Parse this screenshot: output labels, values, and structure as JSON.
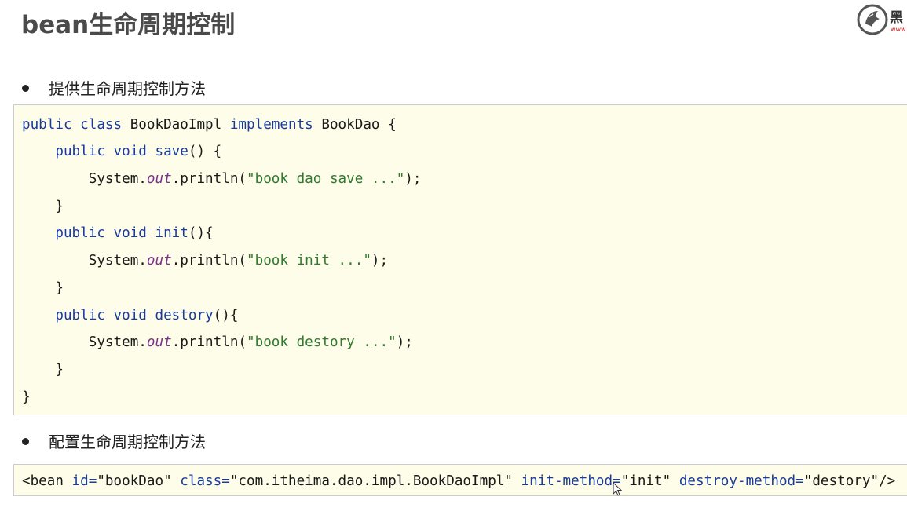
{
  "slide": {
    "title": "bean生命周期控制",
    "logo": {
      "icon": "heima-horse-logo-icon",
      "text": "黑",
      "subtext": "www",
      "accent_color": "#cc2222"
    }
  },
  "sections": [
    {
      "bullet": "提供生命周期控制方法",
      "code_lines": [
        "public class BookDaoImpl implements BookDao {",
        "    public void save() {",
        "        System.out.println(\"book dao save ...\");",
        "    }",
        "    public void init(){",
        "        System.out.println(\"book init ...\");",
        "    }",
        "    public void destory(){",
        "        System.out.println(\"book destory ...\");",
        "    }",
        "}"
      ]
    },
    {
      "bullet": "配置生命周期控制方法",
      "code_lines": [
        "<bean id=\"bookDao\" class=\"com.itheima.dao.impl.BookDaoImpl\" init-method=\"init\" destroy-method=\"destory\"/>"
      ]
    }
  ],
  "code_tokens": {
    "l1": {
      "kw1": "public",
      "kw2": "class",
      "name": "BookDaoImpl",
      "kw3": "implements",
      "rest": "BookDao {"
    },
    "l2": {
      "indent": "    ",
      "kw1": "public",
      "kw2": "void",
      "name": "save",
      "rest": "() {"
    },
    "l3": {
      "indent": "        ",
      "pre": "System.",
      "field": "out",
      "mid": ".println(",
      "str": "\"book dao save ...\"",
      "end": ");"
    },
    "l4": {
      "text": "    }"
    },
    "l5": {
      "indent": "    ",
      "kw1": "public",
      "kw2": "void",
      "name": "init",
      "rest": "(){"
    },
    "l6": {
      "indent": "        ",
      "pre": "System.",
      "field": "out",
      "mid": ".println(",
      "str": "\"book init ...\"",
      "end": ");"
    },
    "l7": {
      "text": "    }"
    },
    "l8": {
      "indent": "    ",
      "kw1": "public",
      "kw2": "void",
      "name": "destory",
      "rest": "(){"
    },
    "l9": {
      "indent": "        ",
      "pre": "System.",
      "field": "out",
      "mid": ".println(",
      "str": "\"book destory ...\"",
      "end": ");"
    },
    "l10": {
      "text": "    }"
    },
    "l11": {
      "text": "}"
    },
    "xml": {
      "open": "<bean ",
      "a1": "id=",
      "v1": "\"bookDao\"",
      "a2": "class=",
      "v2": "\"com.itheima.dao.impl.BookDaoImpl\"",
      "a3": "init-method=",
      "v3": "\"init\"",
      "a4": "destroy-method=",
      "v4": "\"destory\"",
      "close": "/>"
    }
  },
  "colors": {
    "code_background": "#fdfde9",
    "keyword": "#1a3b9c",
    "string": "#2f7a2f",
    "field": "#7b2f8f"
  },
  "cursor": {
    "icon": "mouse-pointer-icon"
  }
}
